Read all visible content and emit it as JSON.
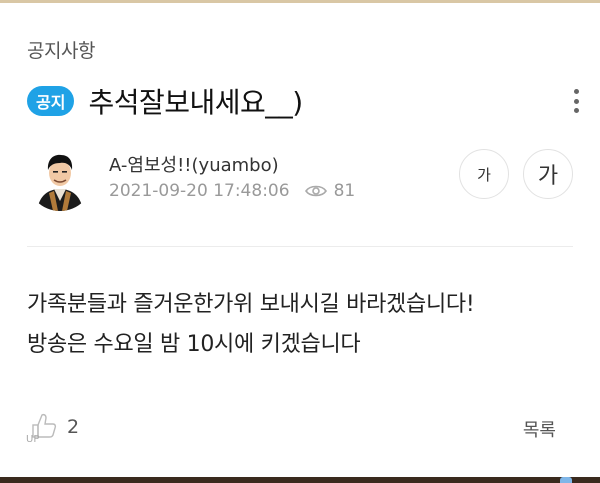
{
  "board": {
    "category": "공지사항"
  },
  "post": {
    "badge": "공지",
    "title": "추석잘보내세요__)",
    "author": "A-염보성!!(yuambo)",
    "date": "2021-09-20 17:48:06",
    "views": "81",
    "body_lines": [
      "가족분들과 즐거운한가위 보내시길 바라겠습니다!",
      "방송은 수요일 밤 10시에 키겠습니다"
    ],
    "likes": "2"
  },
  "controls": {
    "font_small_label": "가",
    "font_large_label": "가",
    "list_label": "목록",
    "like_icon_text": "UP"
  },
  "colors": {
    "badge": "#1fa2e6",
    "top_border": "#d9c7a5"
  },
  "icons": [
    "more-vertical-icon",
    "eye-icon",
    "like-icon"
  ]
}
